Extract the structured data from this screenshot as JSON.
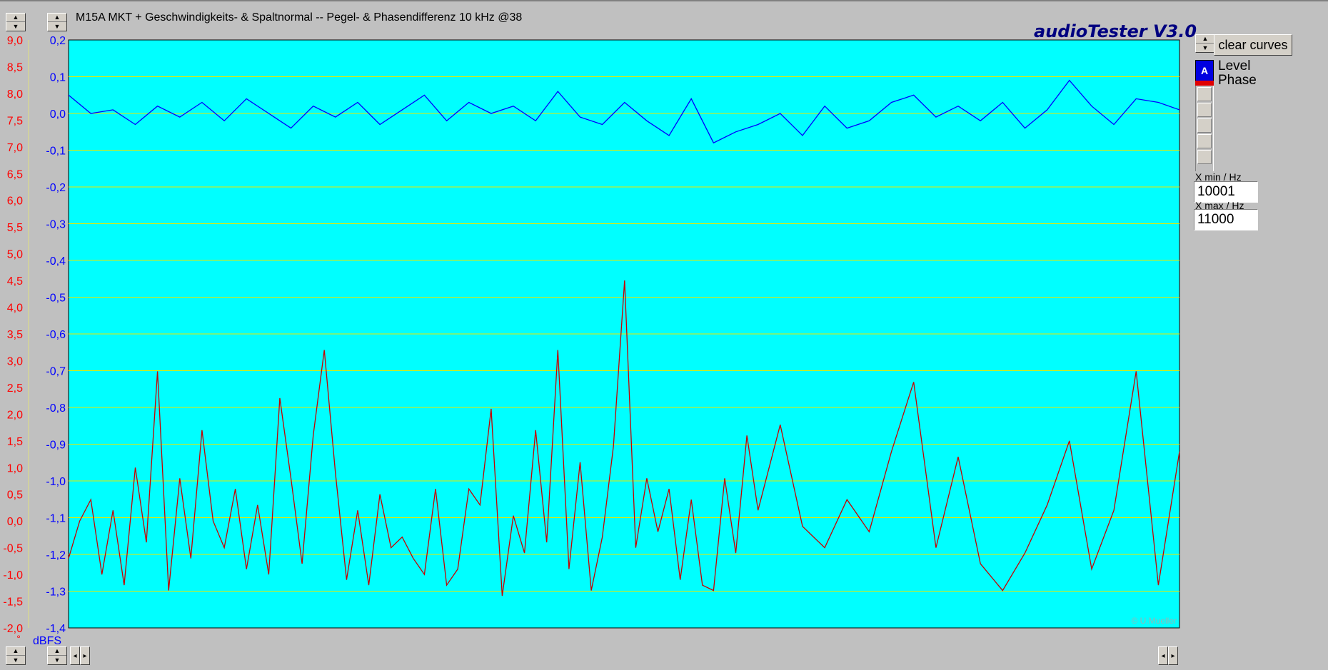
{
  "window": {
    "title": "M15A MKT + Geschwindigkeits- & Spaltnormal -- Pegel- & Phasendifferenz 10 kHz @38",
    "app_title": "audioTester  V3.0"
  },
  "controls": {
    "clear_label": "clear curves",
    "channel_a_label": "A",
    "legend_level": "Level",
    "legend_phase": "Phase",
    "xmin_label": "X min / Hz",
    "xmin_value": "10001",
    "xmax_label": "X max / Hz",
    "xmax_value": "11000"
  },
  "colors": {
    "plot_bg": "#00ffff",
    "grid": "#e8e800",
    "level_curve": "#0000ff",
    "phase_curve": "#c80000",
    "left_axis_text": "#ff0000",
    "right_axis_text": "#0000ff"
  },
  "chart_data": {
    "type": "line",
    "xlabel": "",
    "ylabel_left_unit": "°",
    "ylabel_right_unit": "dBFS",
    "x_range": [
      10001,
      11000
    ],
    "xlim": [
      10001,
      11000
    ],
    "ylim_left": [
      -2.0,
      9.0
    ],
    "ylim_right": [
      -1.4,
      0.2
    ],
    "yticks_left": [
      "9,0",
      "8,5",
      "8,0",
      "7,5",
      "7,0",
      "6,5",
      "6,0",
      "5,5",
      "5,0",
      "4,5",
      "4,0",
      "3,5",
      "3,0",
      "2,5",
      "2,0",
      "1,5",
      "1,0",
      "0,5",
      "0,0",
      "-0,5",
      "-1,0",
      "-1,5",
      "-2,0"
    ],
    "yticks_right": [
      "0,2",
      "0,1",
      "0,0",
      "-0,1",
      "-0,2",
      "-0,3",
      "-0,4",
      "-0,5",
      "-0,6",
      "-0,7",
      "-0,8",
      "-0,9",
      "-1,0",
      "-1,1",
      "-1,2",
      "-1,3",
      "-1,4"
    ],
    "grid": true,
    "watermark": "© U.Mueller",
    "series": [
      {
        "key": "level",
        "color": "#0000ff",
        "axis": "right",
        "x": [
          10001,
          10021,
          10041,
          10061,
          10081,
          10101,
          10121,
          10141,
          10161,
          10181,
          10201,
          10221,
          10241,
          10261,
          10281,
          10301,
          10321,
          10341,
          10361,
          10381,
          10401,
          10421,
          10441,
          10461,
          10481,
          10501,
          10521,
          10541,
          10561,
          10581,
          10601,
          10621,
          10641,
          10661,
          10681,
          10701,
          10721,
          10741,
          10761,
          10781,
          10801,
          10821,
          10841,
          10861,
          10881,
          10901,
          10921,
          10941,
          10961,
          10981,
          11000
        ],
        "values": [
          0.05,
          0.0,
          0.01,
          -0.03,
          0.02,
          -0.01,
          0.03,
          -0.02,
          0.04,
          0.0,
          -0.04,
          0.02,
          -0.01,
          0.03,
          -0.03,
          0.01,
          0.05,
          -0.02,
          0.03,
          0.0,
          0.02,
          -0.02,
          0.06,
          -0.01,
          -0.03,
          0.03,
          -0.02,
          -0.06,
          0.04,
          -0.08,
          -0.05,
          -0.03,
          0.0,
          -0.06,
          0.02,
          -0.04,
          -0.02,
          0.03,
          0.05,
          -0.01,
          0.02,
          -0.02,
          0.03,
          -0.04,
          0.01,
          0.09,
          0.02,
          -0.03,
          0.04,
          0.03,
          0.01
        ]
      },
      {
        "key": "phase",
        "color": "#c80000",
        "axis": "left",
        "x": [
          10001,
          10011,
          10021,
          10031,
          10041,
          10051,
          10061,
          10071,
          10081,
          10091,
          10101,
          10111,
          10121,
          10131,
          10141,
          10151,
          10161,
          10171,
          10181,
          10191,
          10201,
          10211,
          10221,
          10231,
          10241,
          10251,
          10261,
          10271,
          10281,
          10291,
          10301,
          10311,
          10321,
          10331,
          10341,
          10351,
          10361,
          10371,
          10381,
          10391,
          10401,
          10411,
          10421,
          10431,
          10441,
          10451,
          10461,
          10471,
          10481,
          10491,
          10501,
          10511,
          10521,
          10531,
          10541,
          10551,
          10561,
          10571,
          10581,
          10591,
          10601,
          10611,
          10621,
          10641,
          10661,
          10681,
          10701,
          10721,
          10741,
          10761,
          10781,
          10801,
          10821,
          10841,
          10861,
          10881,
          10901,
          10921,
          10941,
          10961,
          10981,
          11000
        ],
        "values": [
          -0.7,
          0.0,
          0.4,
          -1.0,
          0.2,
          -1.2,
          1.0,
          -0.4,
          2.8,
          -1.3,
          0.8,
          -0.7,
          1.7,
          0.0,
          -0.5,
          0.6,
          -0.9,
          0.3,
          -1.0,
          2.3,
          0.8,
          -0.8,
          1.6,
          3.2,
          0.9,
          -1.1,
          0.2,
          -1.2,
          0.5,
          -0.5,
          -0.3,
          -0.7,
          -1.0,
          0.6,
          -1.2,
          -0.9,
          0.6,
          0.3,
          2.1,
          -1.4,
          0.1,
          -0.6,
          1.7,
          -0.4,
          3.2,
          -0.9,
          1.1,
          -1.3,
          -0.3,
          1.4,
          4.5,
          -0.5,
          0.8,
          -0.2,
          0.6,
          -1.1,
          0.4,
          -1.2,
          -1.3,
          0.8,
          -0.6,
          1.6,
          0.2,
          1.8,
          -0.1,
          -0.5,
          0.4,
          -0.2,
          1.3,
          2.6,
          -0.5,
          1.2,
          -0.8,
          -1.3,
          -0.6,
          0.3,
          1.5,
          -0.9,
          0.2,
          2.8,
          -1.2,
          1.3
        ]
      }
    ]
  }
}
